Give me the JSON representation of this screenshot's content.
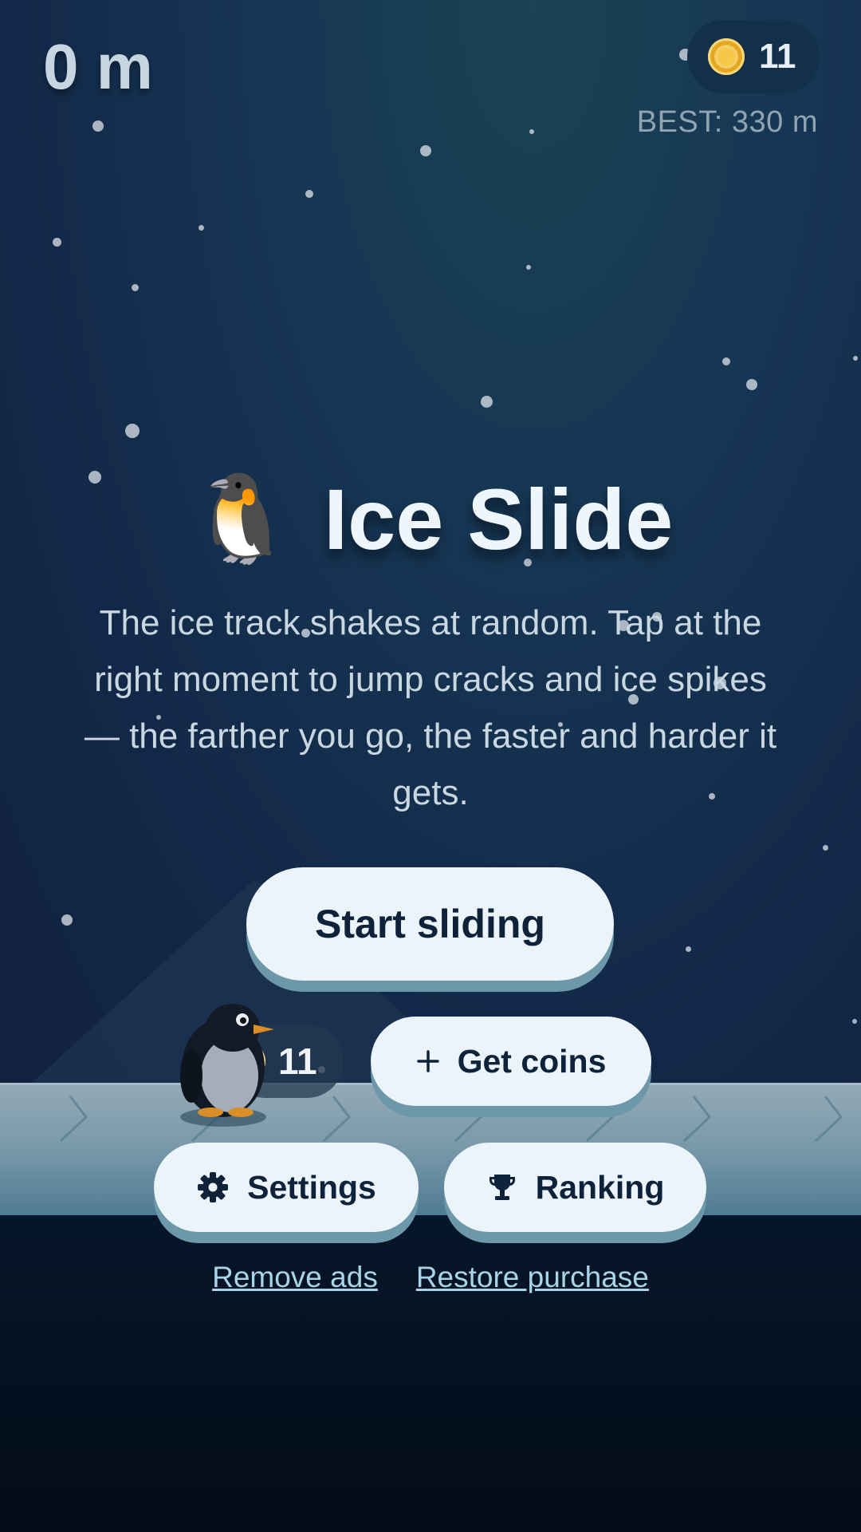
{
  "hud": {
    "distance": "0 m",
    "coins": "11",
    "best": "BEST: 330 m",
    "coin_icon": "coin-icon"
  },
  "title": {
    "icon": "🐧",
    "text": "Ice Slide"
  },
  "description": "The ice track shakes at random. Tap at the right moment to jump cracks and ice spikes — the farther you go, the faster and harder it gets.",
  "buttons": {
    "start": "Start sliding",
    "get_coins": "Get coins",
    "settings": "Settings",
    "ranking": "Ranking"
  },
  "player": {
    "coins": "11"
  },
  "links": {
    "remove_ads": "Remove ads",
    "restore": "Restore purchase"
  },
  "colors": {
    "background": "#132848",
    "button": "#eaf4fa",
    "button_text": "#0e2239",
    "link": "#a9d4e8",
    "coin": "#e5a722"
  }
}
